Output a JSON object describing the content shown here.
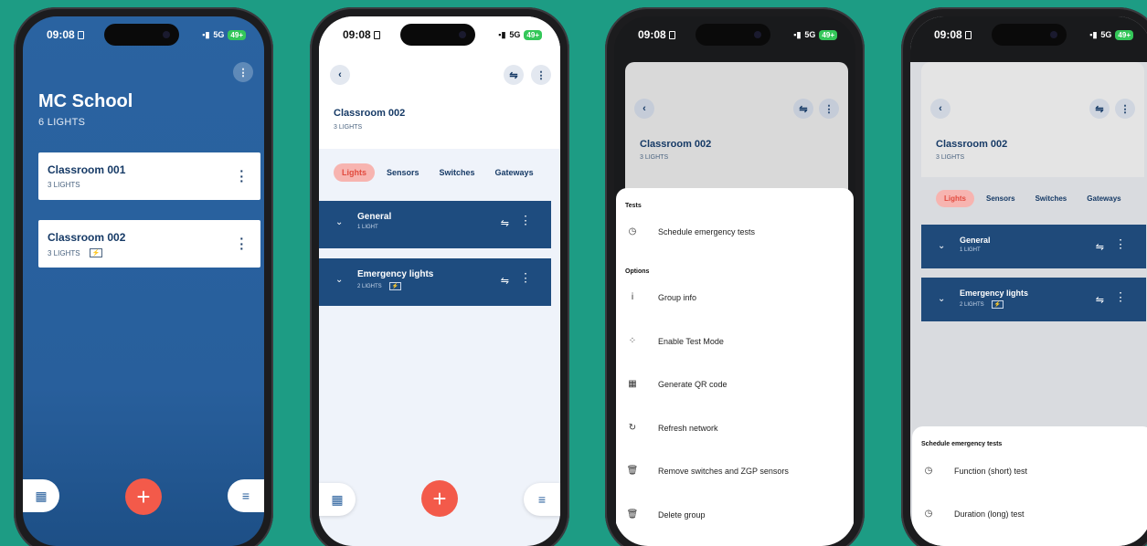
{
  "status": {
    "time": "09:08",
    "network": "5G",
    "battery": "49+"
  },
  "screen1": {
    "title": "MC School",
    "subtitle": "6 LIGHTS",
    "cards": [
      {
        "name": "Classroom 001",
        "sub": "3 LIGHTS"
      },
      {
        "name": "Classroom 002",
        "sub": "3 LIGHTS"
      }
    ],
    "fab": "+"
  },
  "screen2": {
    "title": "Classroom 002",
    "subtitle": "3 LIGHTS",
    "tabs": [
      "Lights",
      "Sensors",
      "Switches",
      "Gateways"
    ],
    "groups": [
      {
        "name": "General",
        "sub": "1 LIGHT"
      },
      {
        "name": "Emergency lights",
        "sub": "2 LIGHTS"
      }
    ],
    "fab": "+"
  },
  "screen3": {
    "title": "Classroom 002",
    "subtitle": "3 LIGHTS",
    "section_tests": "Tests",
    "section_options": "Options",
    "items": [
      "Schedule emergency tests",
      "Group info",
      "Enable Test Mode",
      "Generate QR code",
      "Refresh network",
      "Remove switches and ZGP sensors",
      "Delete group"
    ]
  },
  "screen4": {
    "title": "Classroom 002",
    "subtitle": "3 LIGHTS",
    "tabs": [
      "Lights",
      "Sensors",
      "Switches",
      "Gateways"
    ],
    "groups": [
      {
        "name": "General",
        "sub": "1 LIGHT"
      },
      {
        "name": "Emergency lights",
        "sub": "2 LIGHTS"
      }
    ],
    "sheet_title": "Schedule emergency tests",
    "sheet_items": [
      "Function (short) test",
      "Duration (long) test"
    ]
  },
  "colors": {
    "background": "#1d9c84",
    "brand_blue": "#285f9c",
    "accent_red": "#f35a4a"
  }
}
